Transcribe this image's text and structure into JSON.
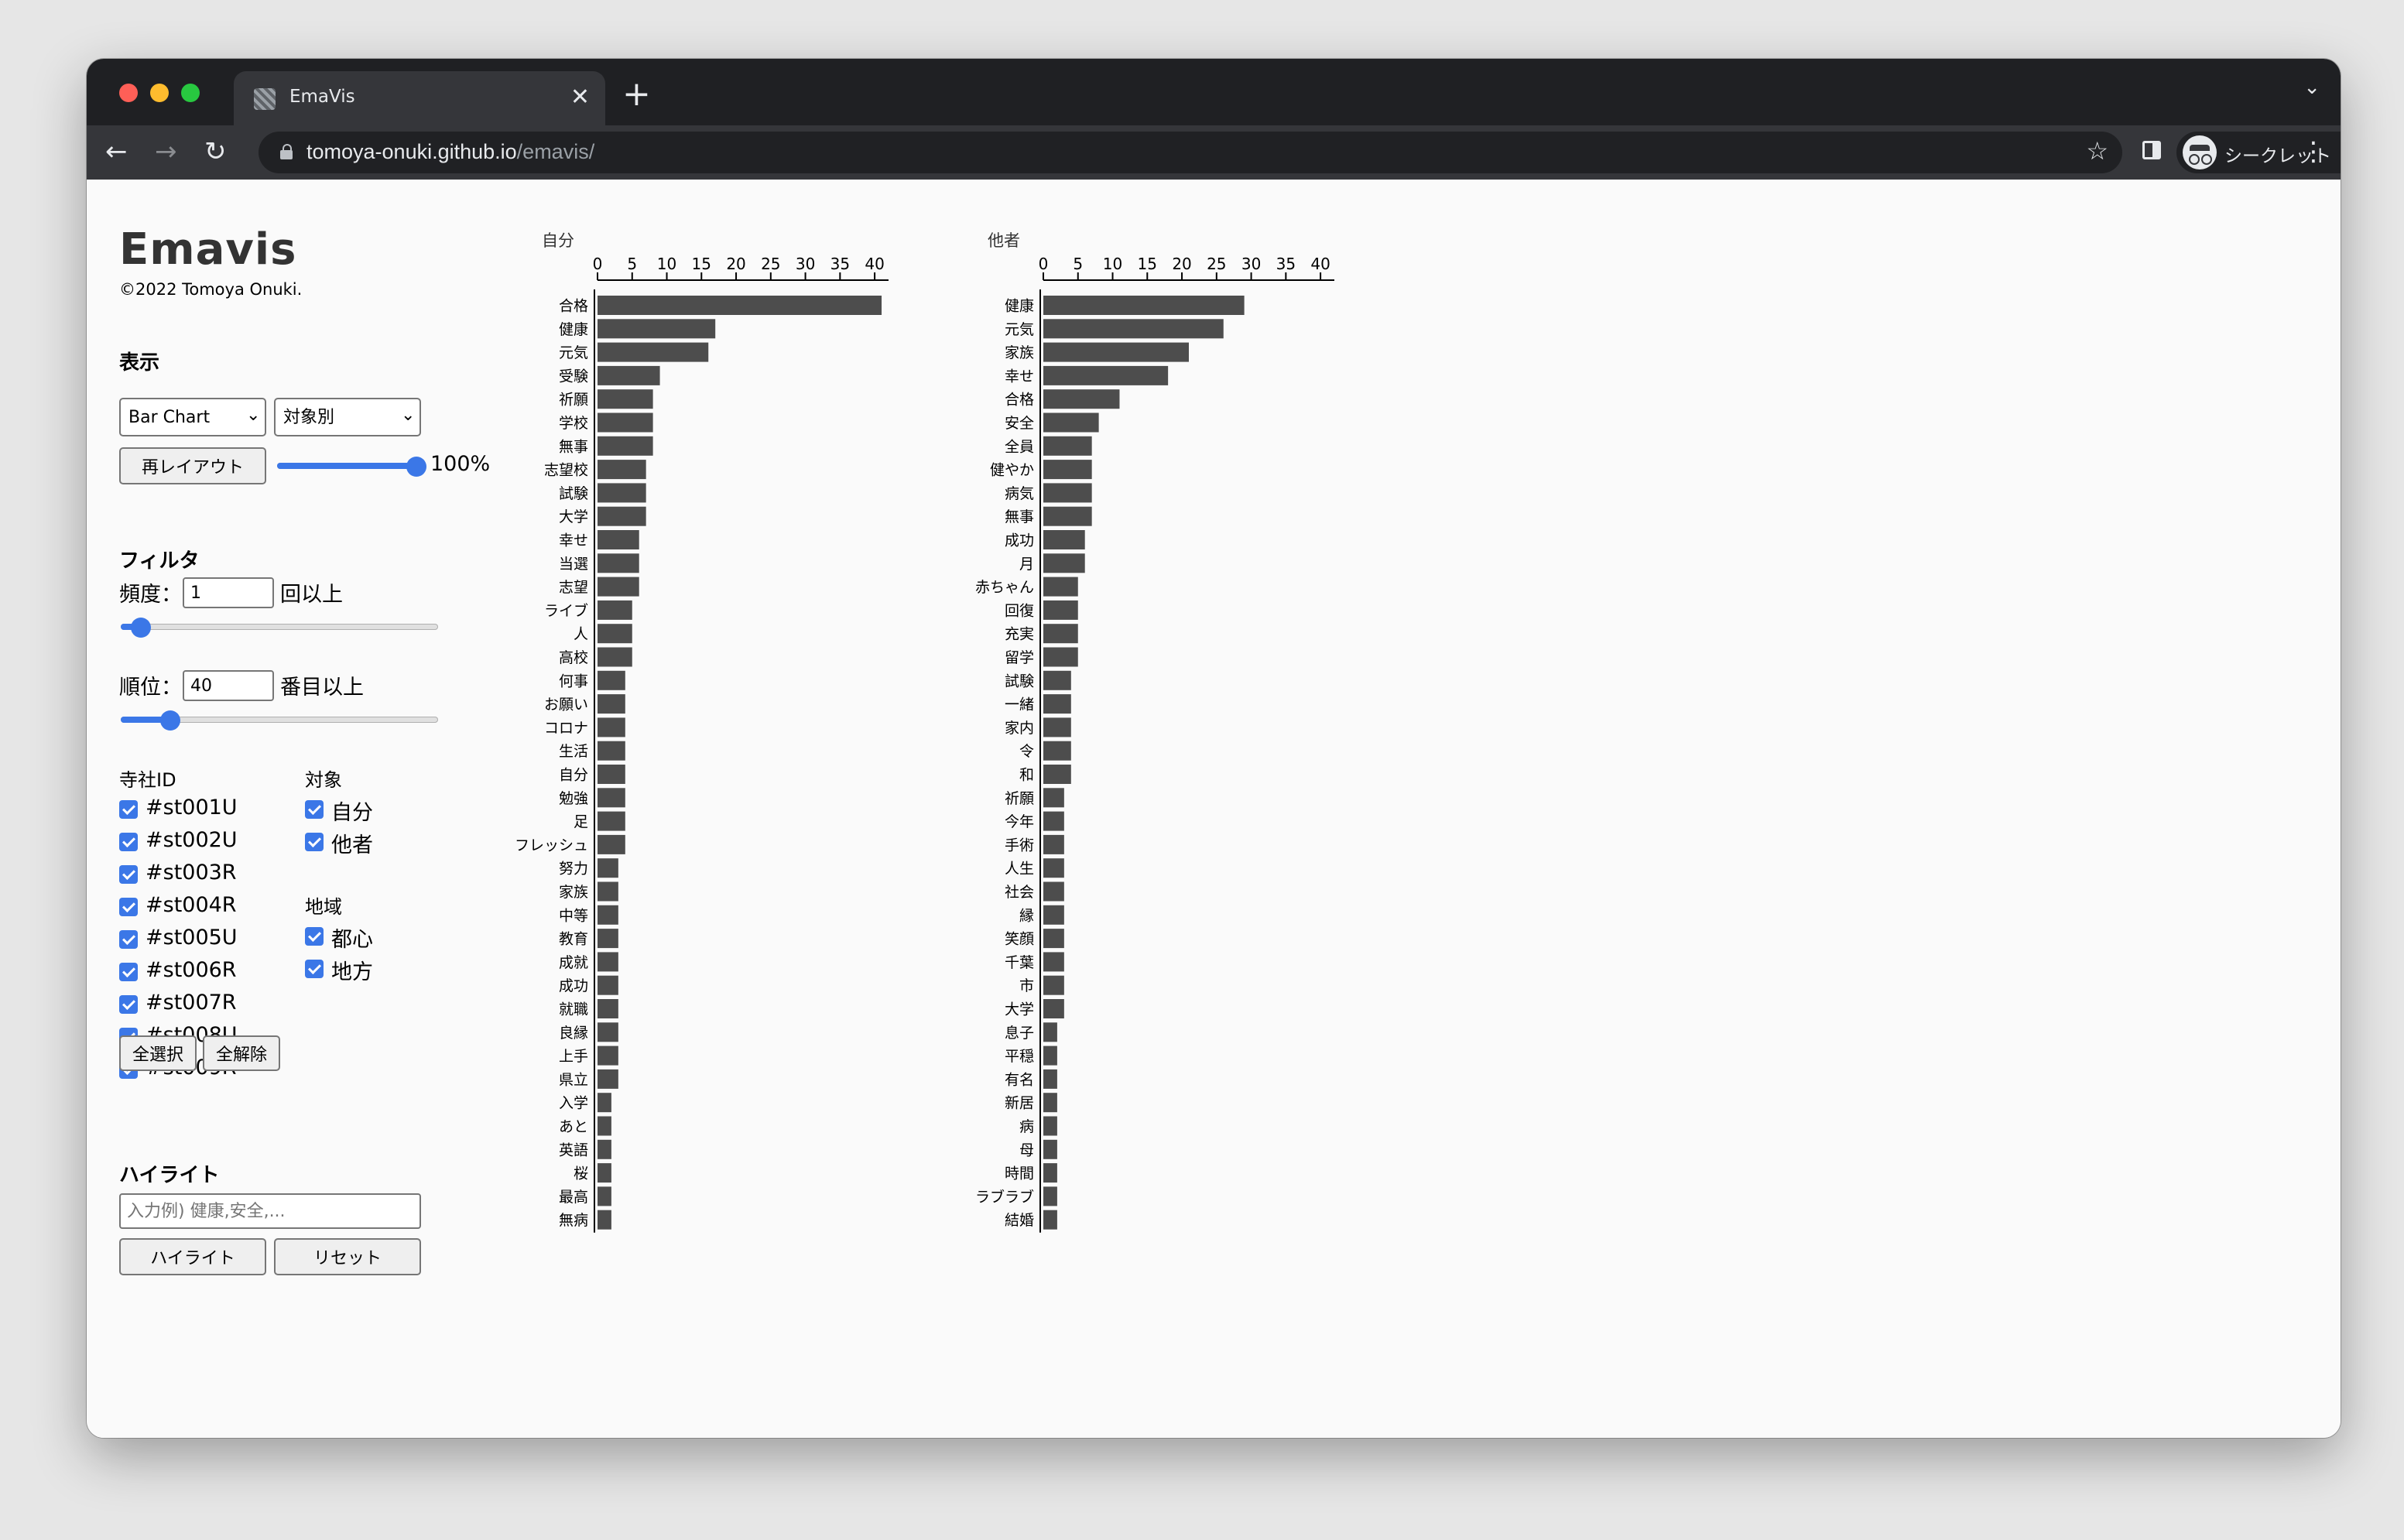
{
  "browser": {
    "tab_title": "EmaVis",
    "url_host": "tomoya-onuki.github.io",
    "url_path": "/emavis/",
    "incognito_label": "シークレット",
    "icons": [
      "favicon-icon",
      "close-icon",
      "plus-icon",
      "back-icon",
      "forward-icon",
      "reload-icon",
      "lock-icon",
      "star-icon",
      "side-panel-icon",
      "incognito-icon",
      "more-icon",
      "chevron-down-icon"
    ]
  },
  "app": {
    "title": "Emavis",
    "copyright": "©2022 Tomoya Onuki."
  },
  "display": {
    "heading": "表示",
    "chart_type": "Bar Chart",
    "grouping": "対象別",
    "relayout_label": "再レイアウト",
    "zoom_value": 1.0,
    "zoom_label": "100%"
  },
  "filter": {
    "heading": "フィルタ",
    "frequency_label": "頻度：",
    "frequency_value": "1",
    "frequency_suffix": "回以上",
    "frequency_slider_value": 1,
    "rank_label": "順位：",
    "rank_value": "40",
    "rank_suffix": "番目以上",
    "rank_slider_value": 40
  },
  "shrine_ids": {
    "heading": "寺社ID",
    "items": [
      {
        "label": "#st001U",
        "checked": true
      },
      {
        "label": "#st002U",
        "checked": true
      },
      {
        "label": "#st003R",
        "checked": true
      },
      {
        "label": "#st004R",
        "checked": true
      },
      {
        "label": "#st005U",
        "checked": true
      },
      {
        "label": "#st006R",
        "checked": true
      },
      {
        "label": "#st007R",
        "checked": true
      },
      {
        "label": "#st008U",
        "checked": true
      },
      {
        "label": "#st009R",
        "checked": true
      }
    ],
    "select_all_label": "全選択",
    "deselect_all_label": "全解除"
  },
  "target": {
    "heading": "対象",
    "items": [
      {
        "label": "自分",
        "checked": true
      },
      {
        "label": "他者",
        "checked": true
      }
    ]
  },
  "region": {
    "heading": "地域",
    "items": [
      {
        "label": "都心",
        "checked": true
      },
      {
        "label": "地方",
        "checked": true
      }
    ]
  },
  "highlight": {
    "heading": "ハイライト",
    "placeholder": "入力例) 健康,安全,...",
    "highlight_label": "ハイライト",
    "reset_label": "リセット"
  },
  "chart_data": [
    {
      "type": "bar",
      "orientation": "horizontal",
      "title": "自分",
      "xlim": [
        0,
        42
      ],
      "ticks": [
        0,
        5,
        10,
        15,
        20,
        25,
        30,
        35,
        40
      ],
      "bar_color": "#4d4d4d",
      "categories": [
        "合格",
        "健康",
        "元気",
        "受験",
        "祈願",
        "学校",
        "無事",
        "志望校",
        "試験",
        "大学",
        "幸せ",
        "当選",
        "志望",
        "ライブ",
        "人",
        "高校",
        "何事",
        "お願い",
        "コロナ",
        "生活",
        "自分",
        "勉強",
        "足",
        "フレッシュ",
        "努力",
        "家族",
        "中等",
        "教育",
        "成就",
        "成功",
        "就職",
        "良縁",
        "上手",
        "県立",
        "入学",
        "あと",
        "英語",
        "桜",
        "最高",
        "無病"
      ],
      "values": [
        41,
        17,
        16,
        9,
        8,
        8,
        8,
        7,
        7,
        7,
        6,
        6,
        6,
        5,
        5,
        5,
        4,
        4,
        4,
        4,
        4,
        4,
        4,
        4,
        3,
        3,
        3,
        3,
        3,
        3,
        3,
        3,
        3,
        3,
        2,
        2,
        2,
        2,
        2,
        2
      ]
    },
    {
      "type": "bar",
      "orientation": "horizontal",
      "title": "他者",
      "xlim": [
        0,
        42
      ],
      "ticks": [
        0,
        5,
        10,
        15,
        20,
        25,
        30,
        35,
        40
      ],
      "bar_color": "#4d4d4d",
      "categories": [
        "健康",
        "元気",
        "家族",
        "幸せ",
        "合格",
        "安全",
        "全員",
        "健やか",
        "病気",
        "無事",
        "成功",
        "月",
        "赤ちゃん",
        "回復",
        "充実",
        "留学",
        "試験",
        "一緒",
        "家内",
        "令",
        "和",
        "祈願",
        "今年",
        "手術",
        "人生",
        "社会",
        "縁",
        "笑顔",
        "千葉",
        "市",
        "大学",
        "息子",
        "平穏",
        "有名",
        "新居",
        "病",
        "母",
        "時間",
        "ラブラブ",
        "結婚"
      ],
      "values": [
        29,
        26,
        21,
        18,
        11,
        8,
        7,
        7,
        7,
        7,
        6,
        6,
        5,
        5,
        5,
        5,
        4,
        4,
        4,
        4,
        4,
        3,
        3,
        3,
        3,
        3,
        3,
        3,
        3,
        3,
        3,
        2,
        2,
        2,
        2,
        2,
        2,
        2,
        2,
        2
      ]
    }
  ]
}
